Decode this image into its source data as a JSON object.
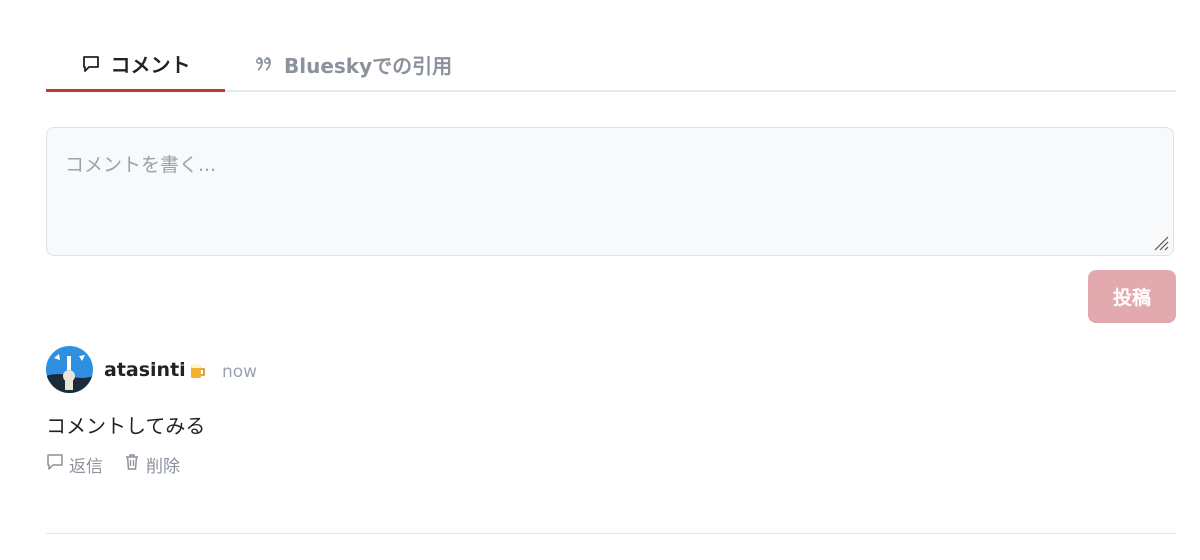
{
  "tabs": [
    {
      "label": "コメント",
      "icon": "comment-icon",
      "active": true
    },
    {
      "label": "Blueskyでの引用",
      "icon": "quote-icon",
      "active": false
    }
  ],
  "composer": {
    "placeholder": "コメントを書く...",
    "submit_label": "投稿"
  },
  "comments": [
    {
      "author": "atasinti",
      "author_emoji": "beer-mug-icon",
      "timestamp": "now",
      "text": "コメントしてみる",
      "actions": {
        "reply_label": "返信",
        "delete_label": "削除"
      }
    }
  ],
  "colors": {
    "accent": "#c0392b",
    "submit_disabled": "#e2a9ae",
    "muted_text": "#8b929c"
  }
}
